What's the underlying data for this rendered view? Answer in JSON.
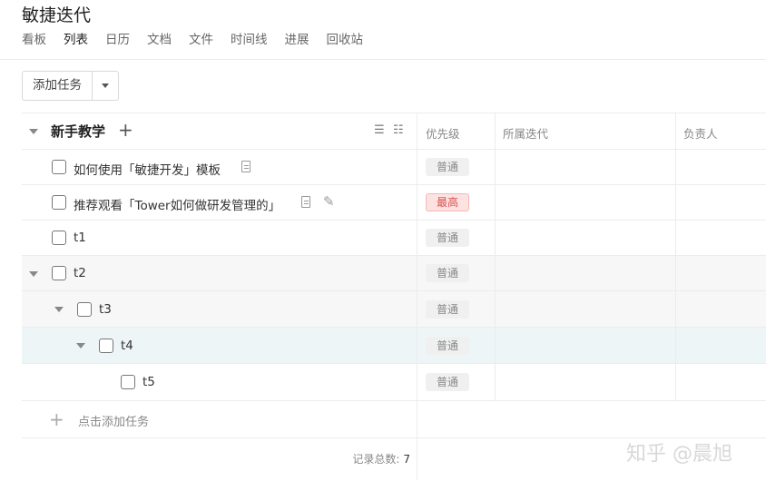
{
  "project": {
    "title": "敏捷迭代"
  },
  "nav": [
    "看板",
    "列表",
    "日历",
    "文档",
    "文件",
    "时间线",
    "进展",
    "回收站"
  ],
  "toolbar": {
    "add_task_label": "添加任务"
  },
  "group": {
    "name": "新手教学"
  },
  "columns": {
    "priority": "优先级",
    "iteration": "所属迭代",
    "assignee": "负责人"
  },
  "tasks": [
    {
      "name": "如何使用「敏捷开发」模板",
      "priority": "普通"
    },
    {
      "name": "推荐观看「Tower如何做研发管理的」",
      "priority": "最高"
    },
    {
      "name": "t1",
      "priority": "普通"
    },
    {
      "name": "t2",
      "priority": "普通"
    },
    {
      "name": "t3",
      "priority": "普通"
    },
    {
      "name": "t4",
      "priority": "普通"
    },
    {
      "name": "t5",
      "priority": "普通"
    }
  ],
  "add_row": {
    "label": "点击添加任务"
  },
  "footer": {
    "label": "记录总数:",
    "count": "7"
  },
  "watermark": "知乎 @晨旭",
  "icons": {
    "group_caret": "chevron-down-icon",
    "add": "plus-icon",
    "doc": "document-icon",
    "attach": "paperclip-icon"
  },
  "colors": {
    "high_priority_bg": "#fde2e2",
    "high_priority_text": "#d9534f",
    "selected_row": "#eef5f6",
    "hover_row": "#f7f7f7"
  }
}
